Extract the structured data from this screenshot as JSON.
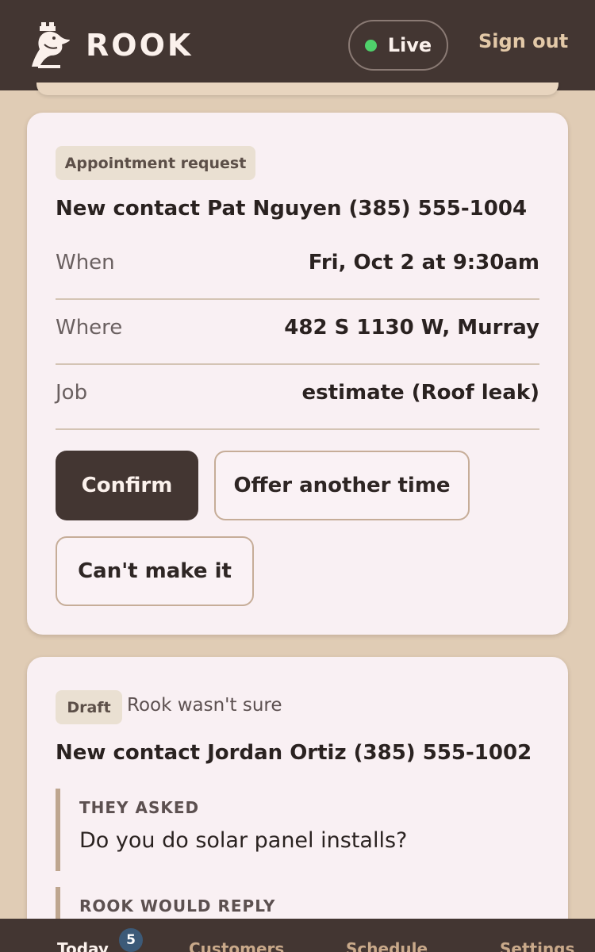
{
  "header": {
    "logo_text": "ROOK",
    "status_label": "Live",
    "sign_out_label": "Sign out",
    "status_color": "#4fd16b"
  },
  "appointment_card": {
    "badge": "Appointment request",
    "contact": "New contact Pat Nguyen (385) 555-1004",
    "details": [
      {
        "label": "When",
        "value": "Fri, Oct 2 at 9:30am"
      },
      {
        "label": "Where",
        "value": "482 S 1130 W, Murray"
      },
      {
        "label": "Job",
        "value": "estimate (Roof leak)"
      }
    ],
    "confirm_label": "Confirm",
    "offer_label": "Offer another time",
    "decline_label": "Can't make it"
  },
  "draft_card": {
    "badge": "Draft",
    "note": "Rook wasn't sure",
    "contact": "New contact Jordan Ortiz (385) 555-1002",
    "asked_label": "THEY ASKED",
    "asked_text": "Do you do solar panel installs?",
    "reply_label": "ROOK WOULD REPLY"
  },
  "bottom_nav": {
    "items": [
      {
        "label": "Today"
      },
      {
        "label": "Customers"
      },
      {
        "label": "Schedule"
      },
      {
        "label": "Settings"
      }
    ],
    "today_badge": "5"
  },
  "colors": {
    "header_bg": "#433632",
    "page_bg": "#e0ccb5",
    "card_bg": "#f9f0f3",
    "accent": "#e3c9a8"
  }
}
